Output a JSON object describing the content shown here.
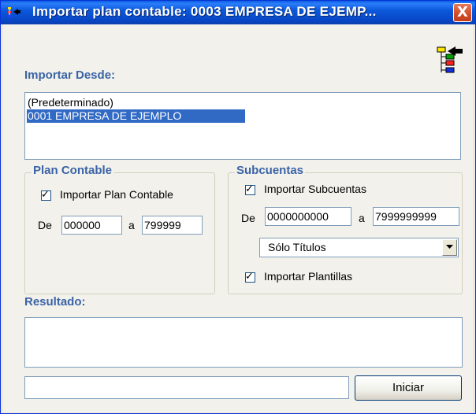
{
  "window": {
    "title": "Importar plan contable: 0003 EMPRESA DE EJEMP...",
    "close_symbol": "X",
    "app_icon": "import-tree-icon"
  },
  "source": {
    "heading": "Importar Desde:",
    "items": [
      {
        "label": "(Predeterminado)",
        "selected": false
      },
      {
        "label": "0001 EMPRESA DE EJEMPLO",
        "selected": true
      }
    ],
    "corner_icon": "import-hierarchy-icon"
  },
  "plan_contable": {
    "title": "Plan Contable",
    "checkbox_label": "Importar Plan Contable",
    "checked": true,
    "from_label": "De",
    "from_value": "000000",
    "to_label": "a",
    "to_value": "799999"
  },
  "subcuentas": {
    "title": "Subcuentas",
    "checkbox_label": "Importar Subcuentas",
    "checked": true,
    "from_label": "De",
    "from_value": "0000000000",
    "to_label": "a",
    "to_value": "7999999999",
    "select_value": "Sólo Títulos",
    "plantillas_label": "Importar Plantillas",
    "plantillas_checked": true
  },
  "resultado": {
    "heading": "Resultado:",
    "text": "",
    "status_text": ""
  },
  "actions": {
    "start_label": "Iniciar"
  },
  "colors": {
    "titlebar": "#0b59dc",
    "heading": "#3a64a6",
    "selection": "#316ac5",
    "close_button": "#d14a26"
  }
}
